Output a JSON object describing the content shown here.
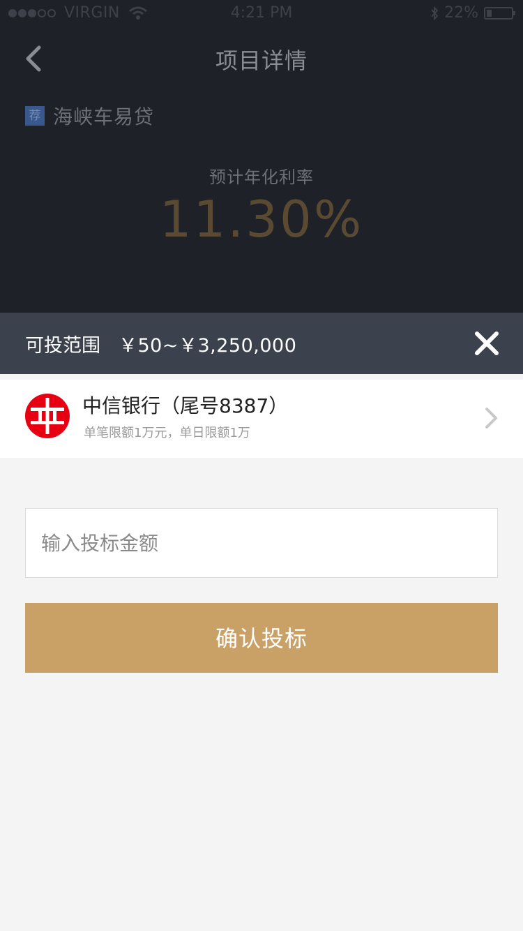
{
  "status_bar": {
    "carrier": "VIRGIN",
    "time": "4:21 PM",
    "battery": "22%",
    "battery_level": 0.22
  },
  "nav": {
    "title": "项目详情",
    "back_icon": "chevron-left-icon"
  },
  "project": {
    "tag": "荐",
    "name": "海峡车易贷",
    "rate_label": "预计年化利率",
    "rate_value": "11.30%"
  },
  "range": {
    "label": "可投范围",
    "value": "￥50~￥3,250,000",
    "close_icon": "close-icon"
  },
  "bank": {
    "name": "中信银行（尾号8387）",
    "limit": "单笔限额1万元，单日限额1万",
    "logo_icon": "citic-bank-logo",
    "logo_color": "#e60012"
  },
  "form": {
    "amount_placeholder": "输入投标金额",
    "amount_value": "",
    "confirm_label": "确认投标"
  },
  "colors": {
    "header_bg": "#1f2129",
    "range_bar_bg": "#3c414e",
    "accent_gold": "#c9a065",
    "rate_text": "#5a4a32",
    "tag_blue": "#39598e"
  }
}
